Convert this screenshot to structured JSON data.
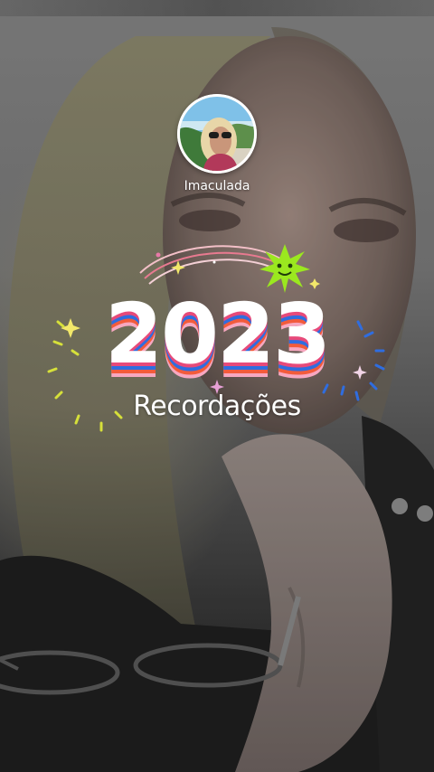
{
  "story": {
    "username": "Imaculada",
    "year": "2023",
    "subtitle": "Recordações"
  },
  "colors": {
    "stripe_pink": "#e74a7a",
    "stripe_blue": "#2f6de0",
    "stripe_orange": "#f25b3c",
    "stripe_light_pink": "#f7a7c0",
    "smiley_green": "#9be81f",
    "sparkle_yellow": "#e8e634",
    "sparkle_blue": "#2f6de0"
  },
  "icons": {
    "smiley_star": "smiley-star-icon",
    "sparkle": "sparkle-icon"
  }
}
